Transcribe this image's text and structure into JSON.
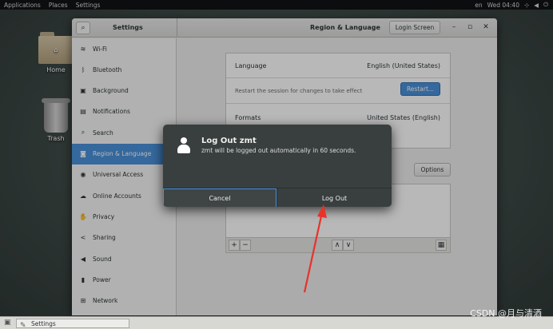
{
  "topbar": {
    "applications": "Applications",
    "places": "Places",
    "settings": "Settings",
    "lang": "en",
    "clock": "Wed 04:40"
  },
  "desktop": {
    "home_label": "Home",
    "trash_label": "Trash"
  },
  "window": {
    "left_title": "Settings",
    "title": "Region & Language",
    "login_screen_button": "Login Screen"
  },
  "sidebar": {
    "items": [
      {
        "label": "Wi-Fi",
        "icon": "wifi-icon",
        "glyph": "≋"
      },
      {
        "label": "Bluetooth",
        "icon": "bluetooth-icon",
        "glyph": "ᛒ"
      },
      {
        "label": "Background",
        "icon": "background-icon",
        "glyph": "▣"
      },
      {
        "label": "Notifications",
        "icon": "bell-icon",
        "glyph": "▤"
      },
      {
        "label": "Search",
        "icon": "search-icon",
        "glyph": "⌕"
      },
      {
        "label": "Region & Language",
        "icon": "camera-icon",
        "glyph": "◙"
      },
      {
        "label": "Universal Access",
        "icon": "accessibility-icon",
        "glyph": "◉"
      },
      {
        "label": "Online Accounts",
        "icon": "cloud-icon",
        "glyph": "☁"
      },
      {
        "label": "Privacy",
        "icon": "hand-icon",
        "glyph": "✋"
      },
      {
        "label": "Sharing",
        "icon": "share-icon",
        "glyph": "<"
      },
      {
        "label": "Sound",
        "icon": "speaker-icon",
        "glyph": "◀"
      },
      {
        "label": "Power",
        "icon": "power-icon",
        "glyph": "▮"
      },
      {
        "label": "Network",
        "icon": "network-icon",
        "glyph": "⊞"
      }
    ],
    "active_index": 5
  },
  "main": {
    "language_label": "Language",
    "language_value": "English (United States)",
    "restart_note": "Restart the session for changes to take effect",
    "restart_button": "Restart...",
    "formats_label": "Formats",
    "formats_value": "United States (English)",
    "options_button": "Options",
    "add_button": "+",
    "remove_button": "−",
    "up_button": "∧",
    "down_button": "∨",
    "keyboard_button": "▦"
  },
  "dialog": {
    "title": "Log Out zmt",
    "message": "zmt will be logged out automatically in 60 seconds.",
    "cancel_button": "Cancel",
    "logout_button": "Log Out"
  },
  "taskbar": {
    "task_label": "Settings"
  },
  "watermark": "CSDN @月与清酒",
  "colors": {
    "accent": "#4a90d9",
    "dialog_bg": "#393f3f",
    "arrow": "#e8322a",
    "topbar_bg": "#101214"
  }
}
